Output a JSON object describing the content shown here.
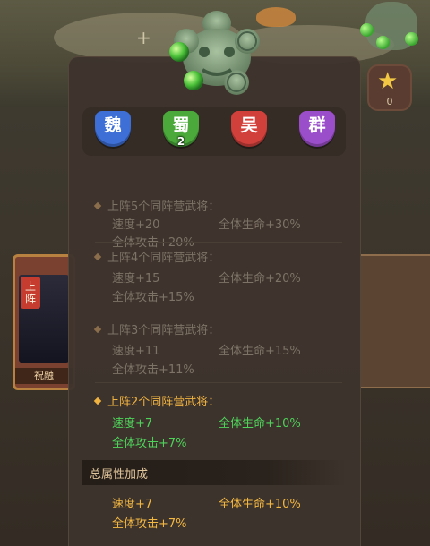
{
  "background": {
    "star_count": "0",
    "side_card": {
      "label": "上阵",
      "name": "祝融"
    }
  },
  "factions": [
    {
      "name": "魏",
      "color": "#3d6fd6",
      "count": ""
    },
    {
      "name": "蜀",
      "color": "#4aa93a",
      "count": "2"
    },
    {
      "name": "吴",
      "color": "#d2403b",
      "count": ""
    },
    {
      "name": "群",
      "color": "#9b4ec9",
      "count": ""
    }
  ],
  "tiers": [
    {
      "title": "上阵5个同阵营武将：",
      "stats": [
        "速度+20",
        "全体生命+30%",
        "全体攻击+20%"
      ],
      "active": false
    },
    {
      "title": "上阵4个同阵营武将：",
      "stats": [
        "速度+15",
        "全体生命+20%",
        "全体攻击+15%"
      ],
      "active": false
    },
    {
      "title": "上阵3个同阵营武将：",
      "stats": [
        "速度+11",
        "全体生命+15%",
        "全体攻击+11%"
      ],
      "active": false
    },
    {
      "title": "上阵2个同阵营武将：",
      "stats": [
        "速度+7",
        "全体生命+10%",
        "全体攻击+7%"
      ],
      "active": true
    }
  ],
  "total": {
    "title": "总属性加成",
    "stats": [
      "速度+7",
      "全体生命+10%",
      "全体攻击+7%"
    ]
  },
  "colors": {
    "active_title": "#f0b340",
    "active_stat": "#4ed35a",
    "locked_text": "#7d7366",
    "total_stat": "#f3b841"
  }
}
